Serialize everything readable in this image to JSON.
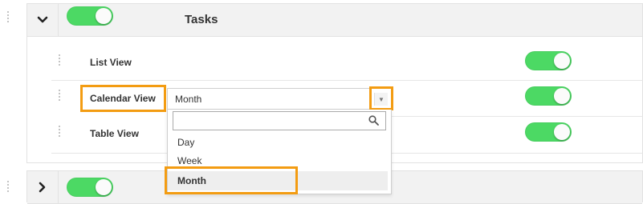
{
  "section1": {
    "title": "Tasks",
    "toggle_on": true,
    "expanded": true,
    "chevron_icon": "chevron-down-icon"
  },
  "rows": [
    {
      "label": "List View",
      "toggle_on": true
    },
    {
      "label": "Calendar View",
      "toggle_on": true
    },
    {
      "label": "Table View",
      "toggle_on": true
    }
  ],
  "view_select": {
    "value": "Month",
    "search_placeholder": "",
    "options": [
      "Day",
      "Week",
      "Month"
    ],
    "selected": "Month"
  },
  "section2": {
    "toggle_on": true,
    "expanded": false,
    "chevron_icon": "chevron-right-icon"
  },
  "colors": {
    "toggle_on": "#4cd964",
    "highlight": "#f39c12",
    "header_bg": "#f2f2f2"
  },
  "icons": {
    "search": "search-icon",
    "drag": "drag-handle-icon",
    "dropdown_arrow": "caret-down-icon"
  }
}
